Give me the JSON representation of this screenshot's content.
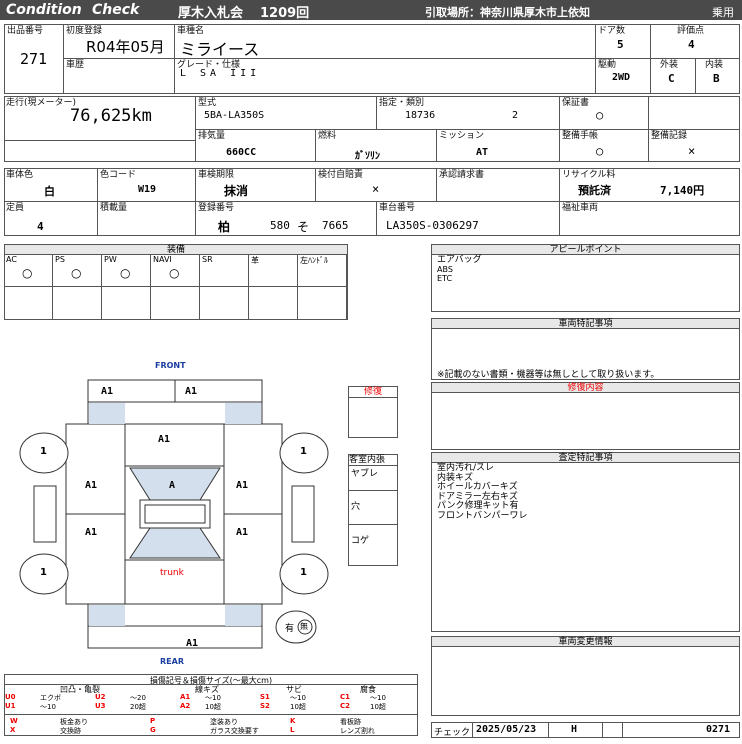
{
  "header": {
    "title1": "Condition",
    "title2": "Check",
    "auction": "厚木入札会",
    "session": "1209回",
    "pickup": "引取場所：神奈川県厚木市上依知",
    "category": "乗用"
  },
  "row1": {
    "exhibit_label": "出品番号",
    "exhibit_no": "271",
    "first_reg_label": "初度登録",
    "first_reg": "R04年05月",
    "model_label": "車種名",
    "model": "ミライース",
    "doors_label": "ドア数",
    "doors": "5",
    "score_label": "評価点",
    "score": "4",
    "history_label": "車歴",
    "grade_label": "グレード・仕様",
    "grade": "L SA III",
    "drive_label": "駆動",
    "drive": "2WD",
    "ext_label": "外装",
    "ext": "C",
    "int_label": "内装",
    "int": "B"
  },
  "row2": {
    "mileage_label": "走行(現メーター)",
    "mileage": "76,625km",
    "type_label": "型式",
    "type": "5BA-LA350S",
    "designation_label": "指定・類別",
    "designation": "18736",
    "class": "2",
    "warranty_label": "保証書",
    "warranty": "○",
    "displacement_label": "排気量",
    "displacement": "660CC",
    "fuel_label": "燃料",
    "fuel": "ｶﾞｿﾘﾝ",
    "mission_label": "ミッション",
    "mission": "AT",
    "maint_book_label": "整備手帳",
    "maint_book": "○",
    "maint_rec_label": "整備記録",
    "maint_rec": "×"
  },
  "row3": {
    "color_label": "車体色",
    "color": "白",
    "colorcode_label": "色コード",
    "colorcode": "W19",
    "inspection_label": "車検期限",
    "inspection": "抹消",
    "liability_label": "検付自賠責",
    "liability": "×",
    "approval_label": "承認請求書",
    "recycle_label": "リサイクル料",
    "recycle_status": "預託済",
    "recycle_fee": "7,140円",
    "capacity_label": "定員",
    "capacity": "4",
    "load_label": "積載量",
    "reg_label": "登録番号",
    "reg_area": "柏",
    "reg_class": "580",
    "reg_kana": "そ",
    "reg_no": "7665",
    "chassis_label": "車台番号",
    "chassis": "LA350S-0306297",
    "welfare_label": "福祉車両"
  },
  "equipment": {
    "title": "装備",
    "items": [
      {
        "label": "AC",
        "value": "○"
      },
      {
        "label": "PS",
        "value": "○"
      },
      {
        "label": "PW",
        "value": "○"
      },
      {
        "label": "NAVI",
        "value": "○"
      },
      {
        "label": "SR",
        "value": ""
      },
      {
        "label": "革",
        "value": ""
      },
      {
        "label": "左ﾊﾝﾄﾞﾙ",
        "value": ""
      }
    ]
  },
  "appeal": {
    "title": "アピールポイント",
    "lines": [
      "エアバッグ",
      "ABS",
      "ETC"
    ]
  },
  "special": {
    "title": "車両特記事項",
    "note": "※記載のない書類・機器等は無しとして取り扱います。"
  },
  "repair": {
    "title": "修復内容",
    "label": "修復"
  },
  "interior": {
    "label": "客室内張",
    "items": [
      "ヤブレ",
      "穴",
      "コゲ"
    ]
  },
  "assessment": {
    "title": "査定特記事項",
    "lines": [
      "室内汚れ/スレ",
      "内装キズ",
      "ホイールカバーキズ",
      "ドアミラー左右キズ",
      "パンク修理キット有",
      "フロントバンパーワレ"
    ]
  },
  "change": {
    "title": "車両変更情報"
  },
  "diagram": {
    "front": "FRONT",
    "rear": "REAR",
    "trunk": "trunk",
    "spare": "有",
    "spare_mark": "無",
    "marks": [
      "A1",
      "A1",
      "A1",
      "A",
      "A1",
      "A1",
      "A1",
      "A1",
      "A1"
    ],
    "tires": [
      "1",
      "1",
      "1",
      "1"
    ]
  },
  "legend": {
    "title": "損傷記号＆損傷サイズ(〜最大cm)",
    "col1": "凹凸・亀裂",
    "col2": "線キズ",
    "col3": "サビ",
    "col4": "腐食",
    "rows": [
      [
        "U0",
        "エクボ",
        "U2",
        "〜20",
        "A1",
        "〜10",
        "S1",
        "〜10",
        "C1",
        "〜10"
      ],
      [
        "U1",
        "〜10",
        "U3",
        "20超",
        "A2",
        "10超",
        "S2",
        "10超",
        "C2",
        "10超"
      ]
    ],
    "rows2": [
      [
        "W",
        "板金あり",
        "P",
        "塗装あり",
        "K",
        "看板跡"
      ],
      [
        "X",
        "交換跡",
        "G",
        "ガラス交換要す",
        "L",
        "レンズ割れ"
      ]
    ]
  },
  "footer": {
    "check_label": "チェック",
    "date": "2025/05/23",
    "inspector": "H",
    "code": "0271"
  }
}
